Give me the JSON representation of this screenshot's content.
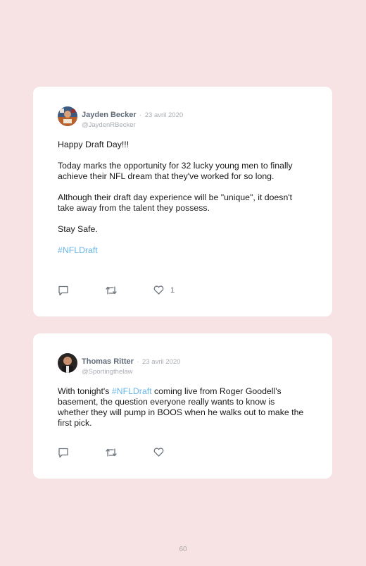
{
  "tweets": [
    {
      "author": "Jayden Becker",
      "separator": "·",
      "date": "23 avril 2020",
      "handle": "@JaydenRBecker",
      "paragraphs": [
        "Happy Draft Day!!!",
        "Today marks the opportunity for 32 lucky young men to finally achieve their NFL dream that they've worked for so long.",
        "Although their draft day experience will be \"unique\", it doesn't take away from the talent they possess.",
        "Stay Safe."
      ],
      "hashtag": "#NFLDraft",
      "like_count": "1"
    },
    {
      "author": "Thomas Ritter",
      "separator": "·",
      "date": "23 avril 2020",
      "handle": "@Sportingthelaw",
      "text_before": "With tonight's ",
      "hashtag": "#NFLDraft",
      "text_after": " coming live from Roger Goodell's basement, the question everyone really wants to know is whether they will pump in BOOS when he walks out to make the first pick."
    }
  ],
  "page_number": "60",
  "colors": {
    "background": "#f7e3e4",
    "card": "#ffffff",
    "hashtag": "#69b6e6",
    "name": "#5f6b78",
    "muted": "#a8adb3"
  },
  "icons": [
    "reply-icon",
    "retweet-icon",
    "like-icon"
  ]
}
